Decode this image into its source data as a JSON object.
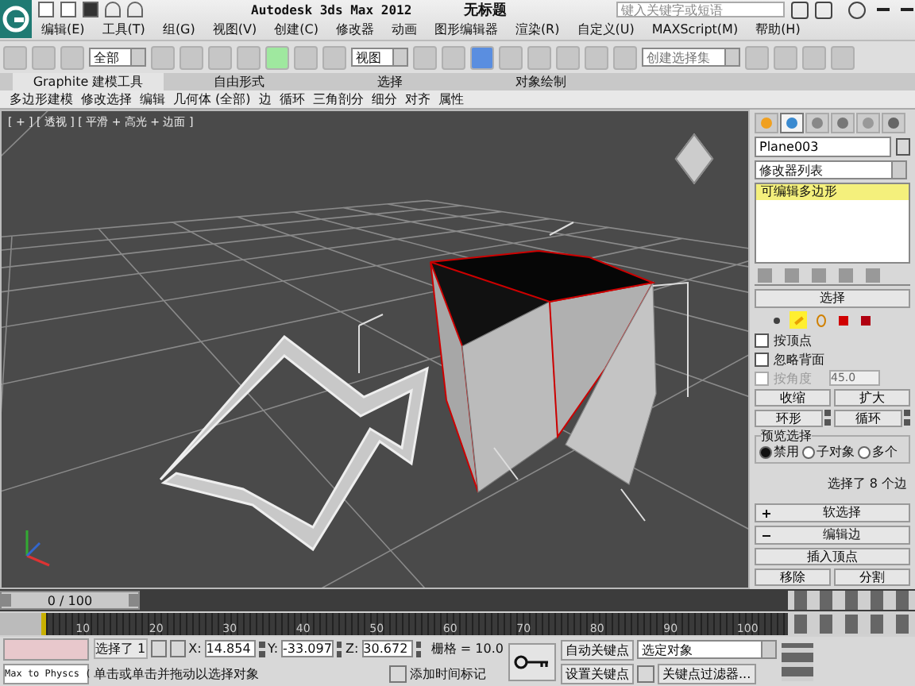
{
  "app": {
    "title": "Autodesk 3ds Max  2012",
    "document": "无标题",
    "search_placeholder": "键入关键字或短语"
  },
  "menu": [
    "编辑(E)",
    "工具(T)",
    "组(G)",
    "视图(V)",
    "创建(C)",
    "修改器",
    "动画",
    "图形编辑器",
    "渲染(R)",
    "自定义(U)",
    "MAXScript(M)",
    "帮助(H)"
  ],
  "toolbar": {
    "selection_filter": "全部",
    "reference_coord": "视图",
    "named_selection_placeholder": "创建选择集"
  },
  "ribbon": {
    "tabs": [
      {
        "label": "Graphite 建模工具",
        "selected": true
      },
      {
        "label": "自由形式",
        "selected": false
      },
      {
        "label": "选择",
        "selected": false
      },
      {
        "label": "对象绘制",
        "selected": false
      }
    ],
    "panels": [
      "多边形建模",
      "修改选择",
      "编辑",
      "几何体 (全部)",
      "边",
      "循环",
      "三角剖分",
      "细分",
      "对齐",
      "属性"
    ]
  },
  "viewport": {
    "label": "[ + ] [ 透视 ] [ 平滑 + 高光 + 边面 ]"
  },
  "command_panel": {
    "tabs": [
      {
        "kind": "create",
        "selected": false
      },
      {
        "kind": "modify",
        "selected": true
      },
      {
        "kind": "hierarchy",
        "selected": false
      },
      {
        "kind": "motion",
        "selected": false
      },
      {
        "kind": "display",
        "selected": false
      },
      {
        "kind": "utilities",
        "selected": false
      }
    ],
    "object_name": "Plane003",
    "modifier_list": "修改器列表",
    "stack": [
      {
        "label": "可编辑多边形",
        "selected": true
      }
    ],
    "selection": {
      "title": "选择",
      "subobjects": [
        {
          "kind": "vertex",
          "selected": false
        },
        {
          "kind": "edge",
          "selected": true
        },
        {
          "kind": "border",
          "selected": false
        },
        {
          "kind": "polygon",
          "selected": false
        },
        {
          "kind": "element",
          "selected": false
        }
      ],
      "options": [
        {
          "label": "按顶点",
          "checked": false,
          "disabled": false
        },
        {
          "label": "忽略背面",
          "checked": false,
          "disabled": false
        },
        {
          "label": "按角度",
          "checked": false,
          "disabled": true,
          "value": "45.0"
        }
      ],
      "buttons": [
        {
          "label": "收缩",
          "kind": "plain"
        },
        {
          "label": "扩大",
          "kind": "plain"
        },
        {
          "label": "环形",
          "kind": "spinner"
        },
        {
          "label": "循环",
          "kind": "spinner"
        }
      ],
      "preview": {
        "title": "预览选择",
        "options": [
          {
            "label": "禁用",
            "selected": true
          },
          {
            "label": "子对象",
            "selected": false
          },
          {
            "label": "多个",
            "selected": false
          }
        ]
      },
      "status": "选择了 8 个边"
    },
    "rollouts": [
      {
        "title": "软选择",
        "expanded": false
      },
      {
        "title": "编辑边",
        "expanded": true
      }
    ],
    "edit_edge_buttons": [
      "插入顶点",
      "移除",
      "分割"
    ]
  },
  "timeline": {
    "frame": "0 / 100",
    "level": 0,
    "ticks": [
      "10",
      "20",
      "30",
      "40",
      "50",
      "60",
      "70",
      "80",
      "90",
      "100"
    ]
  },
  "status_bar": {
    "script_label": "Max to Physcs (",
    "selected": "选择了 1",
    "coords": [
      {
        "axis": "X:",
        "value": "14.854"
      },
      {
        "axis": "Y:",
        "value": "-33.097"
      },
      {
        "axis": "Z:",
        "value": "30.672"
      }
    ],
    "grid": "栅格 = 10.0",
    "prompt": "单击或单击并拖动以选择对象",
    "add_tag": "添加时间标记",
    "auto_key": "自动关键点",
    "set_key": "设置关键点",
    "key_mode": "选定对象",
    "key_filters": "关键点过滤器..."
  }
}
